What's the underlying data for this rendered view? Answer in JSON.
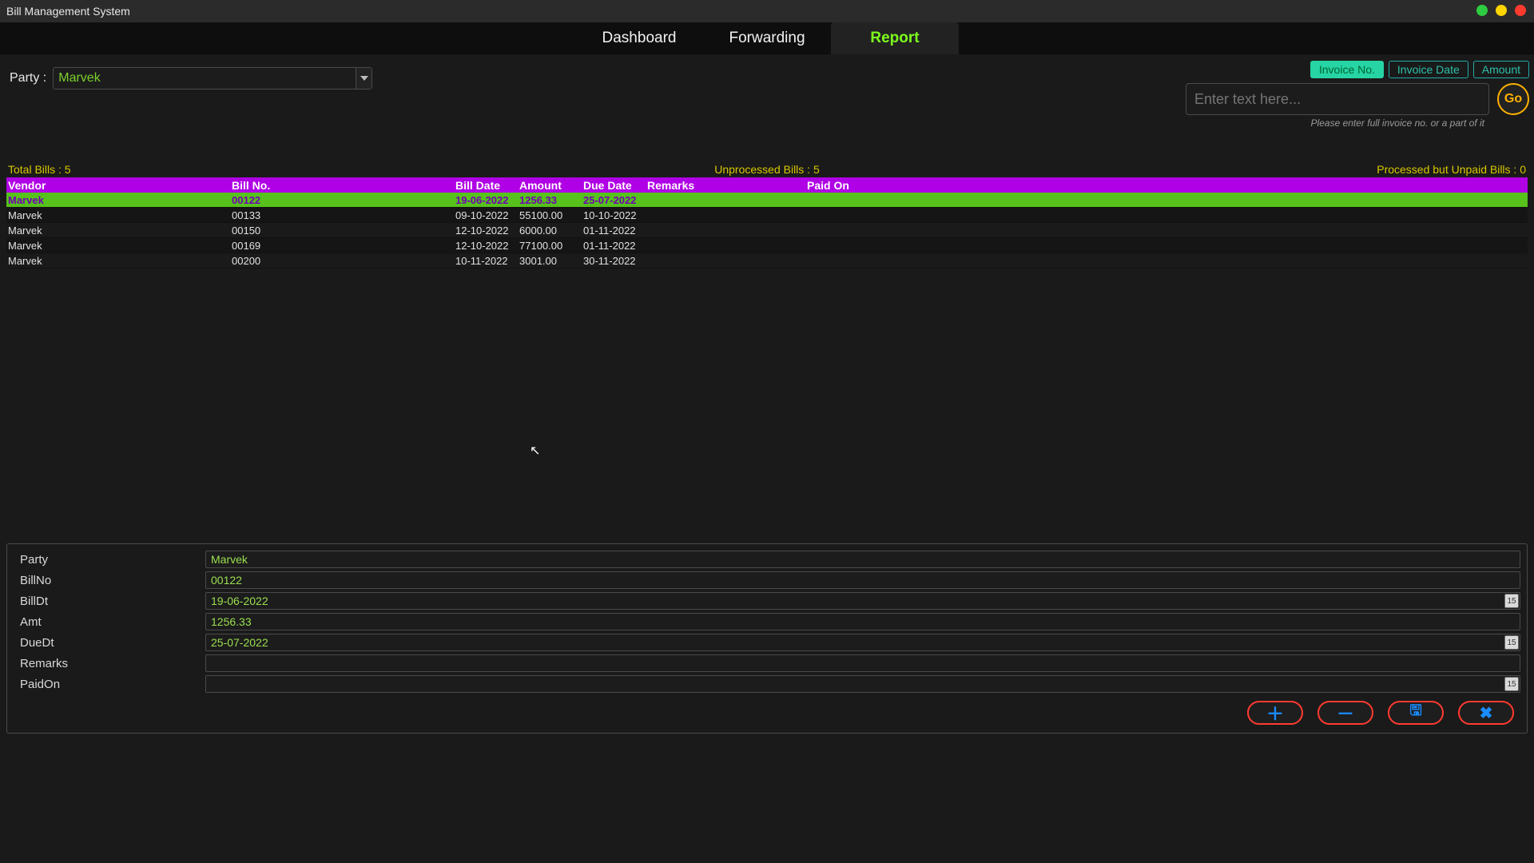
{
  "window": {
    "title": "Bill Management System"
  },
  "nav": {
    "tabs": [
      "Dashboard",
      "Forwarding",
      "Report"
    ],
    "active": 2
  },
  "party": {
    "label": "Party :",
    "value": "Marvek"
  },
  "search": {
    "filters": [
      "Invoice No.",
      "Invoice Date",
      "Amount"
    ],
    "activeFilter": 0,
    "placeholder": "Enter text here...",
    "go": "Go",
    "hint": "Please enter full invoice no. or a part of it"
  },
  "summary": {
    "total": "Total Bills : 5",
    "unprocessed": "Unprocessed Bills : 5",
    "processedUnpaid": "Processed but Unpaid Bills : 0"
  },
  "grid": {
    "headers": [
      "Vendor",
      "Bill No.",
      "Bill Date",
      "Amount",
      "Due Date",
      "Remarks",
      "Paid On"
    ],
    "rows": [
      {
        "vendor": "Marvek",
        "billno": "00122",
        "billdate": "19-06-2022",
        "amount": "1256.33",
        "duedate": "25-07-2022",
        "remarks": "",
        "paidon": "",
        "selected": true
      },
      {
        "vendor": "Marvek",
        "billno": "00133",
        "billdate": "09-10-2022",
        "amount": "55100.00",
        "duedate": "10-10-2022",
        "remarks": "",
        "paidon": ""
      },
      {
        "vendor": "Marvek",
        "billno": "00150",
        "billdate": "12-10-2022",
        "amount": "6000.00",
        "duedate": "01-11-2022",
        "remarks": "",
        "paidon": ""
      },
      {
        "vendor": "Marvek",
        "billno": "00169",
        "billdate": "12-10-2022",
        "amount": "77100.00",
        "duedate": "01-11-2022",
        "remarks": "",
        "paidon": ""
      },
      {
        "vendor": "Marvek",
        "billno": "00200",
        "billdate": "10-11-2022",
        "amount": "3001.00",
        "duedate": "30-11-2022",
        "remarks": "",
        "paidon": ""
      }
    ]
  },
  "form": {
    "labels": {
      "party": "Party",
      "billno": "BillNo",
      "billdt": "BillDt",
      "amt": "Amt",
      "duedt": "DueDt",
      "remarks": "Remarks",
      "paidon": "PaidOn"
    },
    "values": {
      "party": "Marvek",
      "billno": "00122",
      "billdt": "19-06-2022",
      "amt": "1256.33",
      "duedt": "25-07-2022",
      "remarks": "",
      "paidon": ""
    }
  },
  "icons": {
    "calendar": "15"
  }
}
